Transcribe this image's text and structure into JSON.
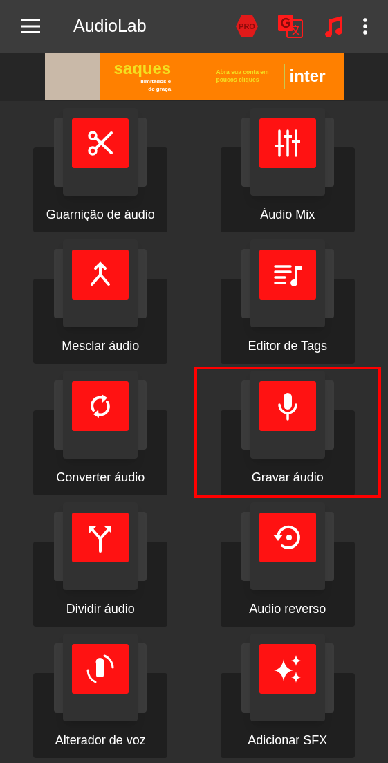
{
  "app_bar": {
    "title": "AudioLab",
    "pro_badge": "PRO"
  },
  "ad_banner": {
    "headline": "saques",
    "subline": "ilimitados e de graça",
    "cta": "Abra sua conta em poucos cliques",
    "brand": "inter"
  },
  "tools": [
    {
      "label": "Guarnição de áudio",
      "selected": false
    },
    {
      "label": "Áudio Mix",
      "selected": false
    },
    {
      "label": "Mesclar áudio",
      "selected": false
    },
    {
      "label": "Editor de Tags",
      "selected": false
    },
    {
      "label": "Converter áudio",
      "selected": false
    },
    {
      "label": "Gravar áudio",
      "selected": true
    },
    {
      "label": "Dividir áudio",
      "selected": false
    },
    {
      "label": "Audio reverso",
      "selected": false
    },
    {
      "label": "Alterador de voz",
      "selected": false
    },
    {
      "label": "Adicionar SFX",
      "selected": false
    }
  ]
}
